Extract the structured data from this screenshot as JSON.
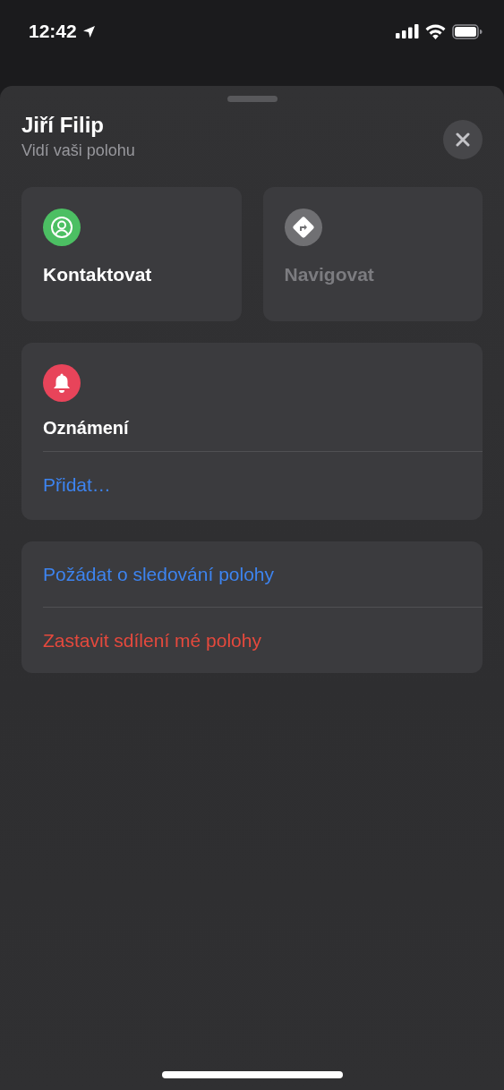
{
  "status_bar": {
    "time": "12:42",
    "location_active": true
  },
  "sheet": {
    "title": "Jiří Filip",
    "subtitle": "Vidí vaši polohu"
  },
  "quick_actions": [
    {
      "label": "Kontaktovat",
      "kind": "contact",
      "color": "#4cbf63",
      "disabled": false
    },
    {
      "label": "Navigovat",
      "kind": "directions",
      "color": "#707073",
      "disabled": true
    }
  ],
  "notifications": {
    "title": "Oznámení",
    "color": "#e8445a",
    "add_label": "Přidat…"
  },
  "actions": [
    {
      "label": "Požádat o sledování polohy",
      "kind": "link"
    },
    {
      "label": "Zastavit sdílení mé polohy",
      "kind": "destructive"
    }
  ]
}
